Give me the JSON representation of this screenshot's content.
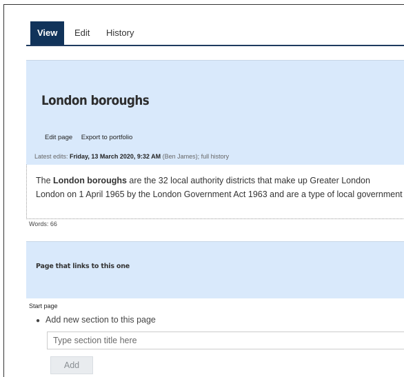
{
  "tabs": [
    {
      "label": "View",
      "active": true
    },
    {
      "label": "Edit",
      "active": false
    },
    {
      "label": "History",
      "active": false
    }
  ],
  "page": {
    "title": "London boroughs",
    "actions": {
      "edit": "Edit page",
      "export": "Export to portfolio"
    },
    "latest_edits": {
      "prefix": "Latest edits: ",
      "date": "Friday, 13 March 2020, 9:32 AM",
      "author": " (Ben James)",
      "sep": "; ",
      "history_link": "full history"
    }
  },
  "content": {
    "line1": {
      "t1": "The ",
      "bold": "London boroughs",
      "t2": " are the 32 local authority districts that make up ",
      "link1": "Greater London"
    },
    "line2": {
      "t1": "London on 1 April 1965 by the ",
      "link1": "London Government Act 1963",
      "t2": " and are a type of local government"
    }
  },
  "word_count": "Words: 66",
  "links_section": {
    "title": "Page that links to this one",
    "start_page": "Start page",
    "add_section_label": "Add new section to this page",
    "input_placeholder": "Type section title here",
    "add_button": "Add"
  },
  "colors": {
    "tab_active_bg": "#11335a",
    "panel_bg": "#d9e9fb"
  }
}
